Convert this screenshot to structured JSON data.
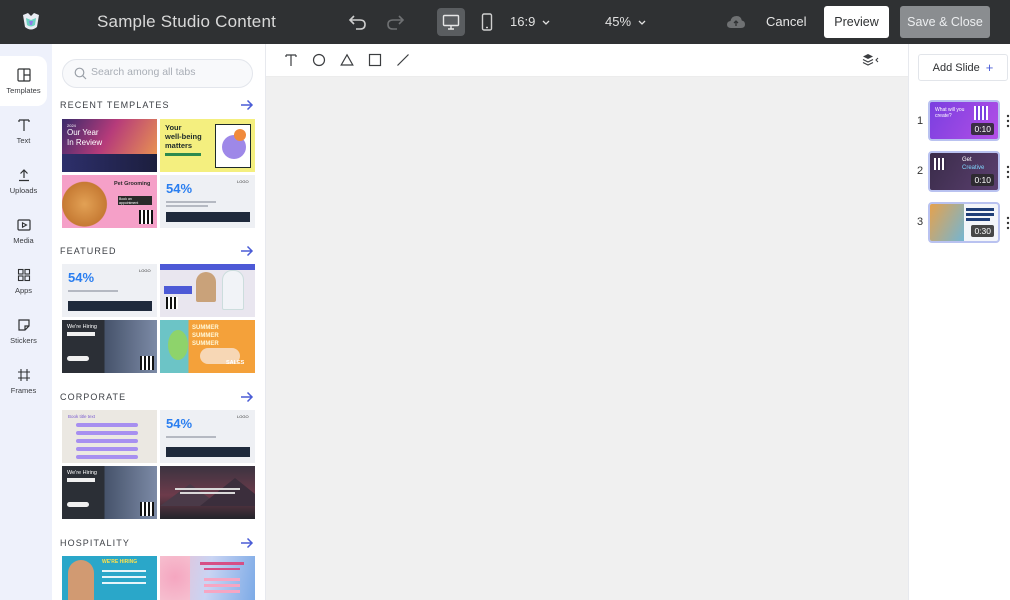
{
  "header": {
    "title": "Sample Studio Content",
    "aspect_ratio": "16:9",
    "zoom": "45%",
    "cancel_label": "Cancel",
    "preview_label": "Preview",
    "save_close_label": "Save & Close"
  },
  "rail": {
    "items": [
      {
        "label": "Templates",
        "icon": "layout-icon",
        "active": true
      },
      {
        "label": "Text",
        "icon": "text-icon"
      },
      {
        "label": "Uploads",
        "icon": "upload-icon"
      },
      {
        "label": "Media",
        "icon": "media-icon"
      },
      {
        "label": "Apps",
        "icon": "apps-grid-icon"
      },
      {
        "label": "Stickers",
        "icon": "sticker-icon"
      },
      {
        "label": "Frames",
        "icon": "frame-icon"
      }
    ]
  },
  "panel": {
    "search_placeholder": "Search among all tabs",
    "sections": [
      {
        "title": "RECENT TEMPLATES"
      },
      {
        "title": "FEATURED"
      },
      {
        "title": "CORPORATE"
      },
      {
        "title": "HOSPITALITY"
      }
    ],
    "thumbs": {
      "year_small": "2024",
      "year_title_1": "Our Year",
      "year_title_2": "In Review",
      "wellbeing_1": "Your",
      "wellbeing_2": "well-being",
      "wellbeing_3": "matters",
      "pet_title": "Pet Grooming",
      "pet_sub": "Book an appointment",
      "stat": "54%",
      "logo": "LOGO",
      "hiring": "We're Hiring",
      "summer": "SUMMER",
      "sales": "SALES",
      "book_title": "Book title text",
      "were_hiring_caps": "WE'RE HIRING"
    }
  },
  "slides": {
    "add_label": "Add Slide",
    "items": [
      {
        "num": "1",
        "duration": "0:10",
        "caption": "What will you create?"
      },
      {
        "num": "2",
        "duration": "0:10",
        "caption_1": "Get",
        "caption_2": "Creative"
      },
      {
        "num": "3",
        "duration": "0:30"
      }
    ]
  },
  "colors": {
    "topbar": "#2f3133",
    "accent": "#4a5cd6",
    "rail_bg": "#eef1fb",
    "canvas_bg": "#f0f0f0"
  }
}
